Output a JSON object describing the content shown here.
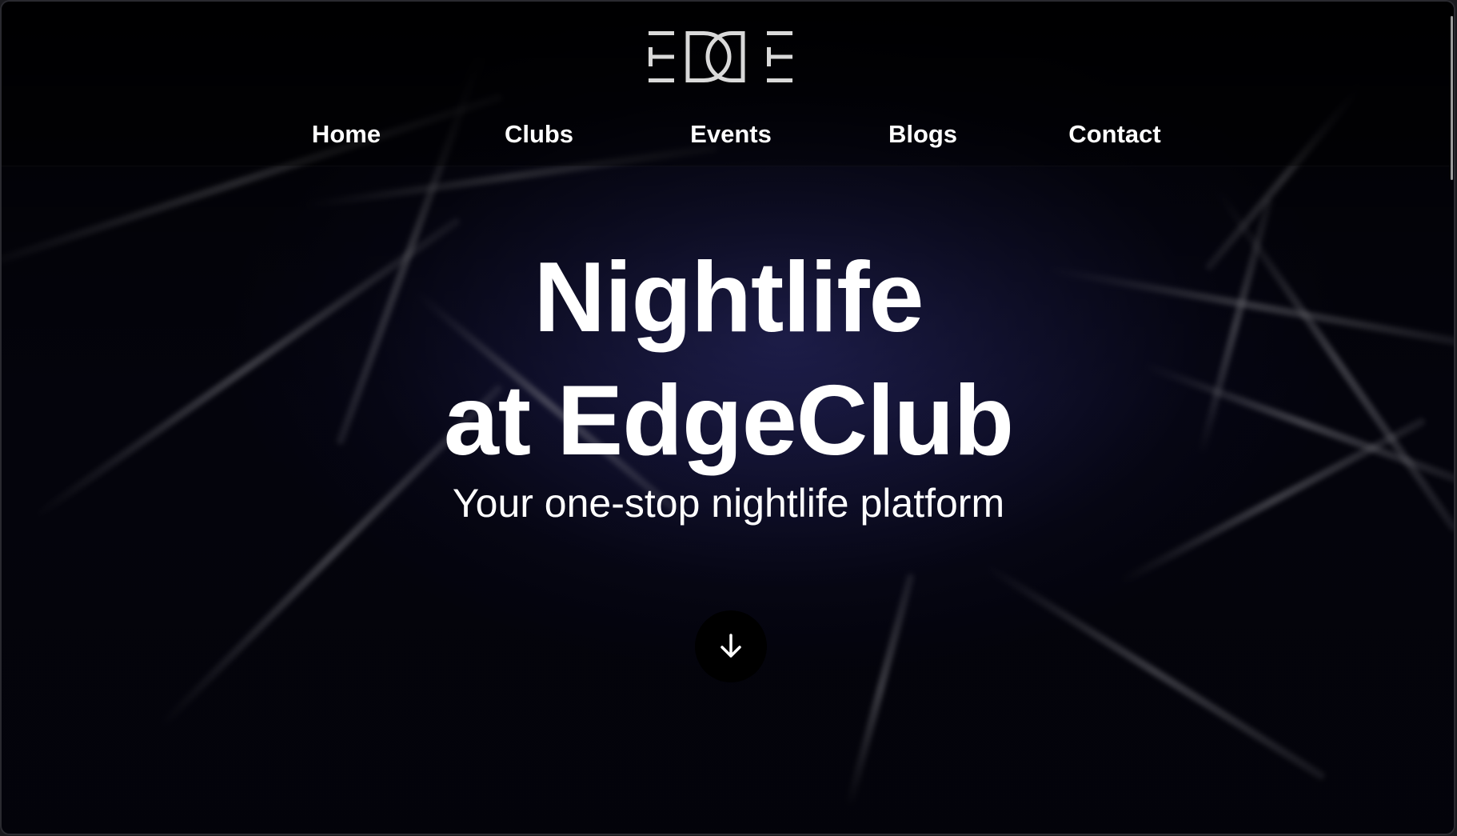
{
  "header": {
    "logo_text": "EDGE",
    "nav": [
      {
        "label": "Home"
      },
      {
        "label": "Clubs"
      },
      {
        "label": "Events"
      },
      {
        "label": "Blogs"
      },
      {
        "label": "Contact"
      }
    ]
  },
  "hero": {
    "title_line1": "Nightlife",
    "title_line2": "at EdgeClub",
    "subtitle": "Your one-stop nightlife platform",
    "scroll_icon": "arrow-down-icon"
  },
  "colors": {
    "background": "#08081a",
    "text": "#ffffff",
    "button": "#000000",
    "logo": "#d9d9d9"
  }
}
